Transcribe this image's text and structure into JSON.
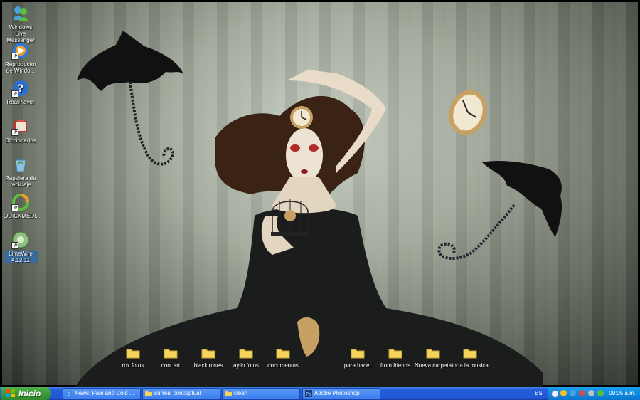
{
  "desktop_icons": [
    {
      "label": "Windows Live Messenger",
      "icon": "messenger-icon",
      "color": "#4aa0e0"
    },
    {
      "label": "Reproductor de Windo...",
      "icon": "media-player-icon",
      "color": "#2f7ad8"
    },
    {
      "label": "RealPlayer",
      "icon": "realplayer-icon",
      "color": "#2a6fd0"
    },
    {
      "label": "Diccionarios",
      "icon": "dictionary-icon",
      "color": "#c03030"
    },
    {
      "label": "Papelera de reciclaje",
      "icon": "recycle-bin-icon",
      "color": "#8fc0e0"
    },
    {
      "label": "QUICKMEDI...",
      "icon": "quickmedia-icon",
      "color": "#5bbf3a"
    },
    {
      "label": "LimeWire 4.12.11",
      "icon": "limewire-icon",
      "color": "#8fc080"
    }
  ],
  "folders": [
    {
      "label": "rox fotos"
    },
    {
      "label": "cool art"
    },
    {
      "label": "black roses"
    },
    {
      "label": "aylin fotos"
    },
    {
      "label": "documentos"
    },
    {
      "label": "para hacer"
    },
    {
      "label": "from  friends"
    },
    {
      "label": "Nueva carpeta"
    },
    {
      "label": "toda la musica"
    }
  ],
  "taskbar": {
    "start_label": "Inicio",
    "tasks": [
      {
        "label": "News: Pale and Cold ...",
        "icon": "internet-explorer-icon"
      },
      {
        "label": "surreal conceptual",
        "icon": "folder-icon"
      },
      {
        "label": "clean",
        "icon": "folder-icon"
      },
      {
        "label": "Adobe Photoshop",
        "icon": "photoshop-icon"
      }
    ],
    "language": "ES",
    "clock": "09:05 a.m."
  },
  "colors": {
    "taskbar_blue": "#245edb",
    "start_green": "#3a9a37",
    "tray_blue": "#0f8ae0",
    "folder_yellow": "#f3d35a"
  }
}
